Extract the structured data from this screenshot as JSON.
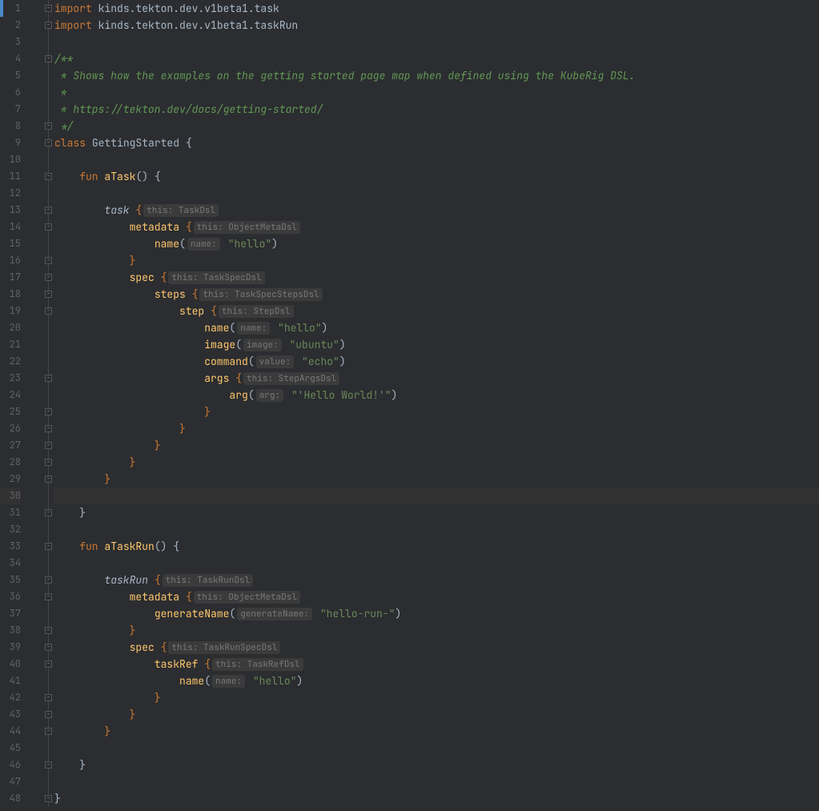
{
  "editor": {
    "highlight_line": 30,
    "breakpoint_line": 1,
    "lines": [
      {
        "n": 1,
        "tokens": [
          [
            "kw",
            "import"
          ],
          [
            "ident",
            " kinds.tekton.dev.v1beta1.task"
          ]
        ]
      },
      {
        "n": 2,
        "tokens": [
          [
            "kw",
            "import"
          ],
          [
            "ident",
            " kinds.tekton.dev.v1beta1.taskRun"
          ]
        ]
      },
      {
        "n": 3,
        "tokens": []
      },
      {
        "n": 4,
        "tokens": [
          [
            "cm",
            "/**"
          ]
        ]
      },
      {
        "n": 5,
        "tokens": [
          [
            "cm",
            " * Shows how the examples on the getting started page map when defined using the KubeRig DSL."
          ]
        ]
      },
      {
        "n": 6,
        "tokens": [
          [
            "cm",
            " *"
          ]
        ]
      },
      {
        "n": 7,
        "tokens": [
          [
            "cm",
            " * https://tekton.dev/docs/getting-started/"
          ]
        ]
      },
      {
        "n": 8,
        "tokens": [
          [
            "cm",
            " */"
          ]
        ]
      },
      {
        "n": 9,
        "tokens": [
          [
            "kw",
            "class"
          ],
          [
            "cls",
            " GettingStarted "
          ],
          [
            "ident",
            "{"
          ]
        ]
      },
      {
        "n": 10,
        "tokens": []
      },
      {
        "n": 11,
        "tokens": [
          [
            "ident",
            "    "
          ],
          [
            "kw",
            "fun"
          ],
          [
            "ident",
            " "
          ],
          [
            "fn",
            "aTask"
          ],
          [
            "ident",
            "() {"
          ]
        ]
      },
      {
        "n": 12,
        "tokens": []
      },
      {
        "n": 13,
        "tokens": [
          [
            "ident",
            "        "
          ],
          [
            "it",
            "task"
          ],
          [
            "ident",
            " "
          ],
          [
            "kw",
            "{"
          ],
          [
            "hint",
            "this: TaskDsl"
          ]
        ]
      },
      {
        "n": 14,
        "tokens": [
          [
            "ident",
            "            "
          ],
          [
            "fn",
            "metadata"
          ],
          [
            "ident",
            " "
          ],
          [
            "kw",
            "{"
          ],
          [
            "hint",
            "this: ObjectMetaDsl"
          ]
        ]
      },
      {
        "n": 15,
        "tokens": [
          [
            "ident",
            "                "
          ],
          [
            "fn",
            "name"
          ],
          [
            "ident",
            "("
          ],
          [
            "hint",
            "name:"
          ],
          [
            "ident",
            " "
          ],
          [
            "str",
            "\"hello\""
          ],
          [
            "ident",
            ")"
          ]
        ]
      },
      {
        "n": 16,
        "tokens": [
          [
            "ident",
            "            "
          ],
          [
            "kw",
            "}"
          ]
        ]
      },
      {
        "n": 17,
        "tokens": [
          [
            "ident",
            "            "
          ],
          [
            "fn",
            "spec"
          ],
          [
            "ident",
            " "
          ],
          [
            "kw",
            "{"
          ],
          [
            "hint",
            "this: TaskSpecDsl"
          ]
        ]
      },
      {
        "n": 18,
        "tokens": [
          [
            "ident",
            "                "
          ],
          [
            "fn",
            "steps"
          ],
          [
            "ident",
            " "
          ],
          [
            "kw",
            "{"
          ],
          [
            "hint",
            "this: TaskSpecStepsDsl"
          ]
        ]
      },
      {
        "n": 19,
        "tokens": [
          [
            "ident",
            "                    "
          ],
          [
            "fn",
            "step"
          ],
          [
            "ident",
            " "
          ],
          [
            "kw",
            "{"
          ],
          [
            "hint",
            "this: StepDsl"
          ]
        ]
      },
      {
        "n": 20,
        "tokens": [
          [
            "ident",
            "                        "
          ],
          [
            "fn",
            "name"
          ],
          [
            "ident",
            "("
          ],
          [
            "hint",
            "name:"
          ],
          [
            "ident",
            " "
          ],
          [
            "str",
            "\"hello\""
          ],
          [
            "ident",
            ")"
          ]
        ]
      },
      {
        "n": 21,
        "tokens": [
          [
            "ident",
            "                        "
          ],
          [
            "fn",
            "image"
          ],
          [
            "ident",
            "("
          ],
          [
            "hint",
            "image:"
          ],
          [
            "ident",
            " "
          ],
          [
            "str",
            "\"ubuntu\""
          ],
          [
            "ident",
            ")"
          ]
        ]
      },
      {
        "n": 22,
        "tokens": [
          [
            "ident",
            "                        "
          ],
          [
            "fn",
            "command"
          ],
          [
            "ident",
            "("
          ],
          [
            "hint",
            "value:"
          ],
          [
            "ident",
            " "
          ],
          [
            "str",
            "\"echo\""
          ],
          [
            "ident",
            ")"
          ]
        ]
      },
      {
        "n": 23,
        "tokens": [
          [
            "ident",
            "                        "
          ],
          [
            "fn",
            "args"
          ],
          [
            "ident",
            " "
          ],
          [
            "kw",
            "{"
          ],
          [
            "hint",
            "this: StepArgsDsl"
          ]
        ]
      },
      {
        "n": 24,
        "tokens": [
          [
            "ident",
            "                            "
          ],
          [
            "fn",
            "arg"
          ],
          [
            "ident",
            "("
          ],
          [
            "hint",
            "arg:"
          ],
          [
            "ident",
            " "
          ],
          [
            "str",
            "\"'Hello World!'\""
          ],
          [
            "ident",
            ")"
          ]
        ]
      },
      {
        "n": 25,
        "tokens": [
          [
            "ident",
            "                        "
          ],
          [
            "kw",
            "}"
          ]
        ]
      },
      {
        "n": 26,
        "tokens": [
          [
            "ident",
            "                    "
          ],
          [
            "kw",
            "}"
          ]
        ]
      },
      {
        "n": 27,
        "tokens": [
          [
            "ident",
            "                "
          ],
          [
            "kw",
            "}"
          ]
        ]
      },
      {
        "n": 28,
        "tokens": [
          [
            "ident",
            "            "
          ],
          [
            "kw",
            "}"
          ]
        ]
      },
      {
        "n": 29,
        "tokens": [
          [
            "ident",
            "        "
          ],
          [
            "kw",
            "}"
          ]
        ]
      },
      {
        "n": 30,
        "tokens": []
      },
      {
        "n": 31,
        "tokens": [
          [
            "ident",
            "    }"
          ]
        ]
      },
      {
        "n": 32,
        "tokens": []
      },
      {
        "n": 33,
        "tokens": [
          [
            "ident",
            "    "
          ],
          [
            "kw",
            "fun"
          ],
          [
            "ident",
            " "
          ],
          [
            "fn",
            "aTaskRun"
          ],
          [
            "ident",
            "() {"
          ]
        ]
      },
      {
        "n": 34,
        "tokens": []
      },
      {
        "n": 35,
        "tokens": [
          [
            "ident",
            "        "
          ],
          [
            "it",
            "taskRun"
          ],
          [
            "ident",
            " "
          ],
          [
            "kw",
            "{"
          ],
          [
            "hint",
            "this: TaskRunDsl"
          ]
        ]
      },
      {
        "n": 36,
        "tokens": [
          [
            "ident",
            "            "
          ],
          [
            "fn",
            "metadata"
          ],
          [
            "ident",
            " "
          ],
          [
            "kw",
            "{"
          ],
          [
            "hint",
            "this: ObjectMetaDsl"
          ]
        ]
      },
      {
        "n": 37,
        "tokens": [
          [
            "ident",
            "                "
          ],
          [
            "fn",
            "generateName"
          ],
          [
            "ident",
            "("
          ],
          [
            "hint",
            "generateName:"
          ],
          [
            "ident",
            " "
          ],
          [
            "str",
            "\"hello-run-\""
          ],
          [
            "ident",
            ")"
          ]
        ]
      },
      {
        "n": 38,
        "tokens": [
          [
            "ident",
            "            "
          ],
          [
            "kw",
            "}"
          ]
        ]
      },
      {
        "n": 39,
        "tokens": [
          [
            "ident",
            "            "
          ],
          [
            "fn",
            "spec"
          ],
          [
            "ident",
            " "
          ],
          [
            "kw",
            "{"
          ],
          [
            "hint",
            "this: TaskRunSpecDsl"
          ]
        ]
      },
      {
        "n": 40,
        "tokens": [
          [
            "ident",
            "                "
          ],
          [
            "fn",
            "taskRef"
          ],
          [
            "ident",
            " "
          ],
          [
            "kw",
            "{"
          ],
          [
            "hint",
            "this: TaskRefDsl"
          ]
        ]
      },
      {
        "n": 41,
        "tokens": [
          [
            "ident",
            "                    "
          ],
          [
            "fn",
            "name"
          ],
          [
            "ident",
            "("
          ],
          [
            "hint",
            "name:"
          ],
          [
            "ident",
            " "
          ],
          [
            "str",
            "\"hello\""
          ],
          [
            "ident",
            ")"
          ]
        ]
      },
      {
        "n": 42,
        "tokens": [
          [
            "ident",
            "                "
          ],
          [
            "kw",
            "}"
          ]
        ]
      },
      {
        "n": 43,
        "tokens": [
          [
            "ident",
            "            "
          ],
          [
            "kw",
            "}"
          ]
        ]
      },
      {
        "n": 44,
        "tokens": [
          [
            "ident",
            "        "
          ],
          [
            "kw",
            "}"
          ]
        ]
      },
      {
        "n": 45,
        "tokens": []
      },
      {
        "n": 46,
        "tokens": [
          [
            "ident",
            "    }"
          ]
        ]
      },
      {
        "n": 47,
        "tokens": []
      },
      {
        "n": 48,
        "tokens": [
          [
            "ident",
            "}"
          ]
        ]
      }
    ],
    "fold_open": [
      1,
      2,
      4,
      8,
      9,
      11,
      13,
      14,
      16,
      17,
      18,
      19,
      23,
      25,
      26,
      27,
      28,
      29,
      31,
      33,
      35,
      36,
      38,
      39,
      40,
      42,
      43,
      44,
      46,
      48
    ]
  }
}
